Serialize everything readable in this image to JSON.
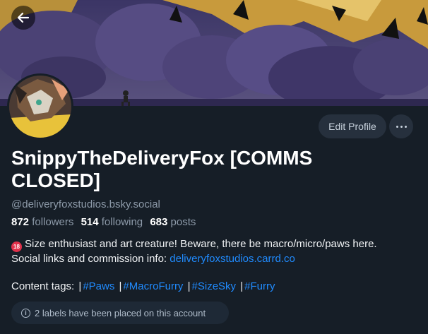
{
  "profile": {
    "display_name": "SnippyTheDeliveryFox [COMMS CLOSED]",
    "handle": "@deliveryfoxstudios.bsky.social",
    "followers_count": "872",
    "followers_label": "followers",
    "following_count": "514",
    "following_label": "following",
    "posts_count": "683",
    "posts_label": "posts"
  },
  "actions": {
    "edit_profile_label": "Edit Profile"
  },
  "bio": {
    "emoji_text": "18",
    "line1": "Size enthusiast and art creature! Beware, there be macro/micro/paws here.",
    "line2_prefix": "Social links and commission info: ",
    "link": "deliveryfoxstudios.carrd.co"
  },
  "content_tags": {
    "label": "Content tags:",
    "separator": "|",
    "tags": [
      "#Paws",
      "#MacroFurry",
      "#SizeSky",
      "#Furry"
    ]
  },
  "labels_notice": "2 labels have been placed on this account",
  "icons": {
    "back": "back-arrow-icon",
    "more": "more-dots-icon",
    "info": "info-icon"
  },
  "colors": {
    "background": "#161e27",
    "link": "#208bfe",
    "button_bg": "#26303d",
    "muted_text": "#8d9aa9"
  }
}
